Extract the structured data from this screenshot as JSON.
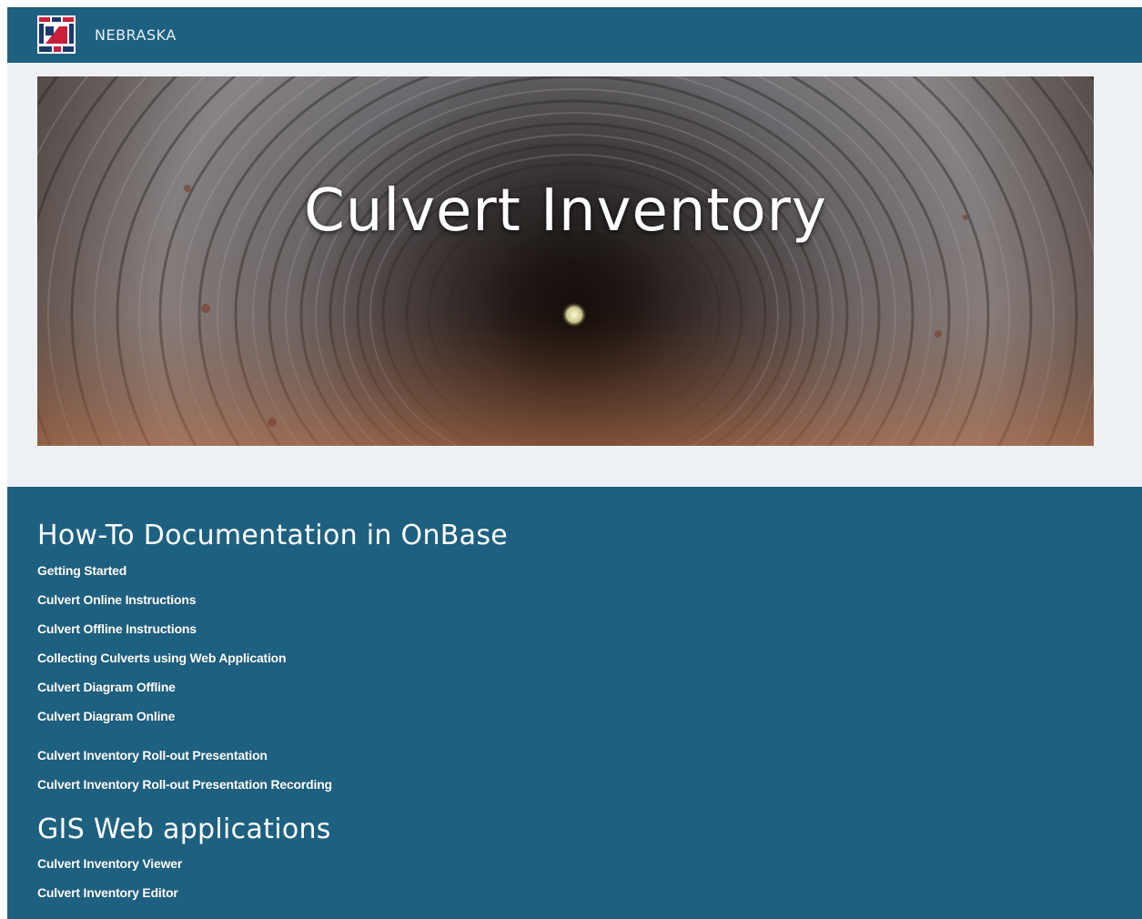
{
  "header": {
    "brand": "NEBRASKA",
    "colors": {
      "bar": "#1e6080",
      "logo_red": "#c8203a",
      "logo_navy": "#1b3a6b"
    }
  },
  "hero": {
    "title": "Culvert Inventory"
  },
  "documentation": {
    "title": "How-To Documentation in OnBase",
    "links": [
      "Getting Started",
      "Culvert Online Instructions",
      "Culvert Offline Instructions",
      "Collecting Culverts using Web Application",
      "Culvert Diagram Offline",
      "Culvert Diagram Online",
      "Culvert Inventory Roll-out Presentation",
      "Culvert Inventory Roll-out Presentation Recording"
    ]
  },
  "gis": {
    "title": "GIS Web applications",
    "links": [
      "Culvert Inventory Viewer",
      "Culvert Inventory Editor"
    ]
  },
  "icons": {
    "logo": "nebraska-state-logo-icon"
  }
}
